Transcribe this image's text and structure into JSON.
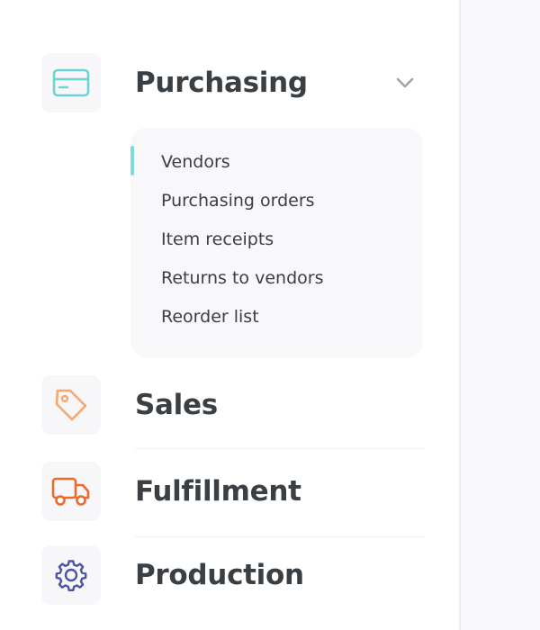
{
  "sidebar": {
    "sections": [
      {
        "id": "purchasing",
        "label": "Purchasing",
        "icon": "credit-card-icon",
        "icon_color": "#6dd3d6",
        "expanded": true
      },
      {
        "id": "sales",
        "label": "Sales",
        "icon": "tag-icon",
        "icon_color": "#f7a76c",
        "expanded": false
      },
      {
        "id": "fulfillment",
        "label": "Fulfillment",
        "icon": "truck-icon",
        "icon_color": "#ec6a2c",
        "expanded": false
      },
      {
        "id": "production",
        "label": "Production",
        "icon": "gear-icon",
        "icon_color": "#4b55a8",
        "expanded": false
      }
    ],
    "purchasing_submenu": {
      "active_index": 0,
      "active_color": "#7fd9e0",
      "items": [
        {
          "label": "Vendors"
        },
        {
          "label": "Purchasing orders"
        },
        {
          "label": "Item receipts"
        },
        {
          "label": "Returns to vendors"
        },
        {
          "label": "Reorder list"
        }
      ]
    }
  }
}
